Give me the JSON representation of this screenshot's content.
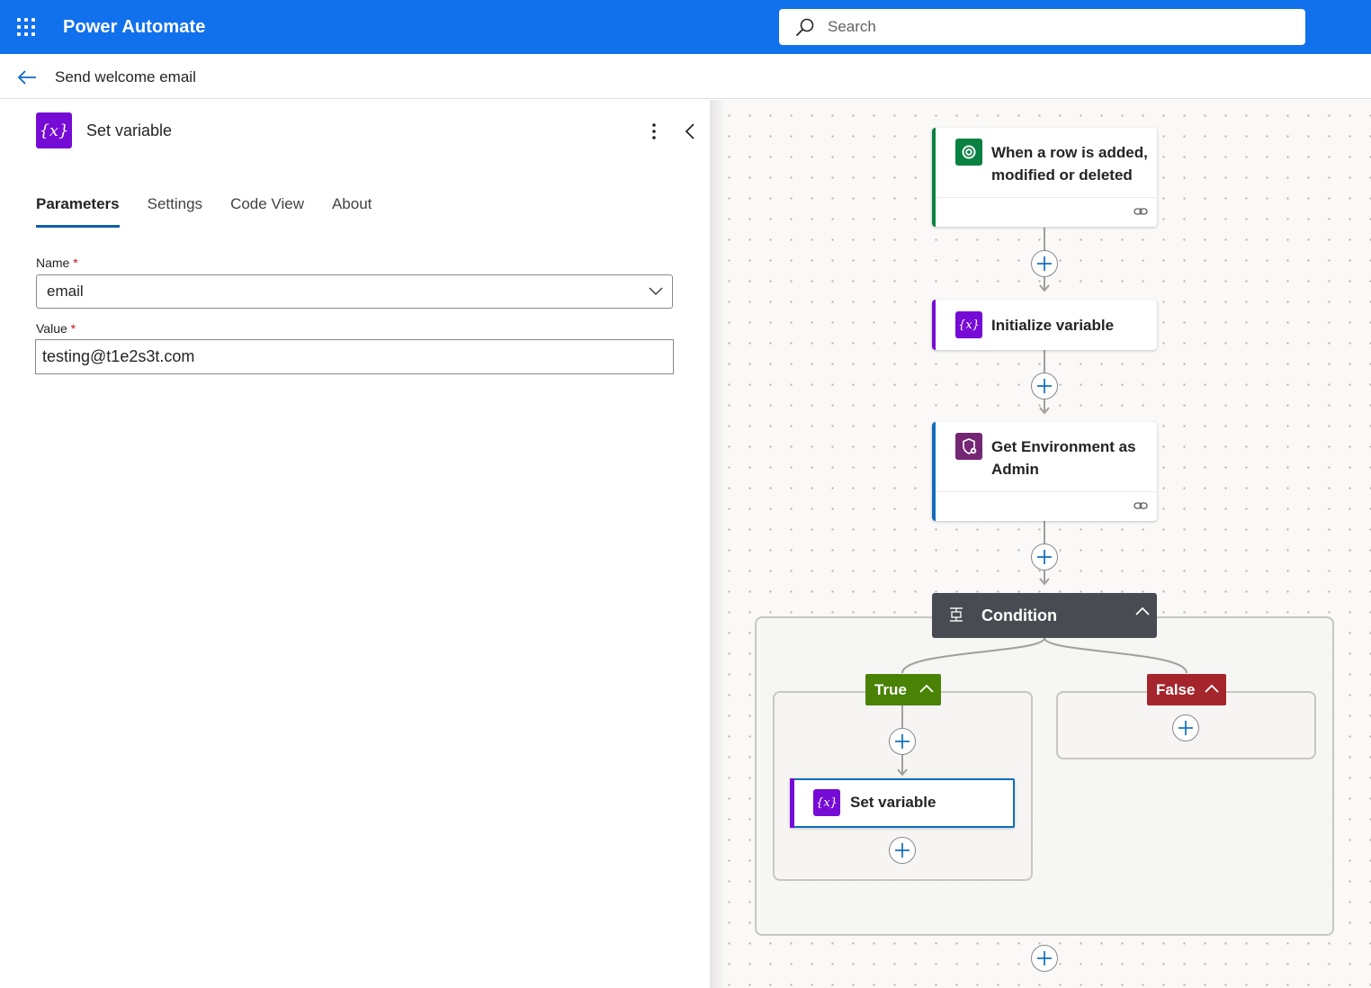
{
  "app": {
    "title": "Power Automate",
    "accent": "#1170ec"
  },
  "search": {
    "placeholder": "Search"
  },
  "flow": {
    "name": "Send welcome email"
  },
  "panel": {
    "title": "Set variable",
    "icon": "variable-icon",
    "tabs": [
      {
        "label": "Parameters",
        "active": true
      },
      {
        "label": "Settings",
        "active": false
      },
      {
        "label": "Code View",
        "active": false
      },
      {
        "label": "About",
        "active": false
      }
    ],
    "name_field": {
      "label": "Name",
      "required_mark": "*",
      "value": "email"
    },
    "value_field": {
      "label": "Value",
      "required_mark": "*",
      "value": "testing@t1e2s3t.com"
    }
  },
  "canvas": {
    "trigger": {
      "title": "When a row is added, modified or deleted",
      "line1": "When a row is added,",
      "line2": "modified or deleted",
      "color": "#088142",
      "icon": "dataverse-icon"
    },
    "init_variable": {
      "title": "Initialize variable",
      "color": "#770bd6",
      "icon": "variable-icon"
    },
    "get_env": {
      "title": "Get Environment as Admin",
      "line1": "Get Environment as",
      "line2": "Admin",
      "color": "#742774",
      "icon": "admin-shield-icon"
    },
    "condition": {
      "title": "Condition",
      "color": "#484c52",
      "icon": "condition-icon"
    },
    "true_branch": {
      "label": "True",
      "color": "#498205"
    },
    "false_branch": {
      "label": "False",
      "color": "#a4262c"
    },
    "set_variable": {
      "title": "Set variable",
      "color": "#770bd6",
      "icon": "variable-icon"
    }
  }
}
